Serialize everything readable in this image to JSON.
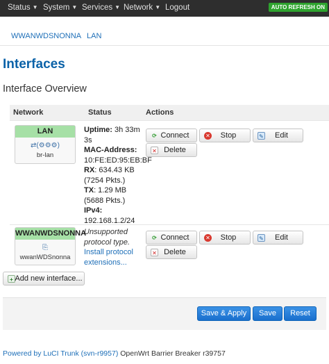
{
  "topnav": {
    "items": [
      {
        "label": "Status",
        "has_dropdown": true
      },
      {
        "label": "System",
        "has_dropdown": true
      },
      {
        "label": "Services",
        "has_dropdown": true
      },
      {
        "label": "Network",
        "has_dropdown": true
      },
      {
        "label": "Logout",
        "has_dropdown": false
      }
    ],
    "auto_refresh": "AUTO REFRESH ON"
  },
  "tabs": [
    "WWANWDSNONNA",
    "LAN"
  ],
  "page": {
    "title": "Interfaces",
    "section_title": "Interface Overview"
  },
  "table": {
    "headers": {
      "network": "Network",
      "status": "Status",
      "actions": "Actions"
    },
    "rows": [
      {
        "name": "LAN",
        "header_color": "#a6e0a6",
        "device": "br-lan",
        "status": {
          "uptime_label": "Uptime:",
          "uptime": "3h 33m 3s",
          "mac_label": "MAC-Address:",
          "mac": "10:FE:ED:95:EB:BF",
          "rx_label": "RX",
          "rx": ": 634.43 KB (7254 Pkts.)",
          "tx_label": "TX",
          "tx": ": 1.29 MB (5688 Pkts.)",
          "ipv4_label": "IPv4:",
          "ipv4": "192.168.1.2/24"
        },
        "actions": {
          "connect": "Connect",
          "stop": "Stop",
          "edit": "Edit",
          "delete": "Delete"
        }
      },
      {
        "name": "WWANWDSNONNA",
        "header_color": "#a6e0a6",
        "device": "wwanWDSnonna",
        "status": {
          "unsupported": "Unsupported protocol type.",
          "install_link": "Install protocol extensions..."
        },
        "actions": {
          "connect": "Connect",
          "stop": "Stop",
          "edit": "Edit",
          "delete": "Delete"
        }
      }
    ],
    "add_button": "Add new interface..."
  },
  "form_actions": {
    "save_apply": "Save & Apply",
    "save": "Save",
    "reset": "Reset"
  },
  "footer": {
    "link": "Powered by LuCI Trunk (svn-r9957)",
    "version": " OpenWrt Barrier Breaker r39757"
  },
  "colors": {
    "topbar": "#2e2e2e",
    "accent": "#0b62a8",
    "primary_button": "#1a6fcd",
    "auto_refresh": "#2ea32e"
  }
}
